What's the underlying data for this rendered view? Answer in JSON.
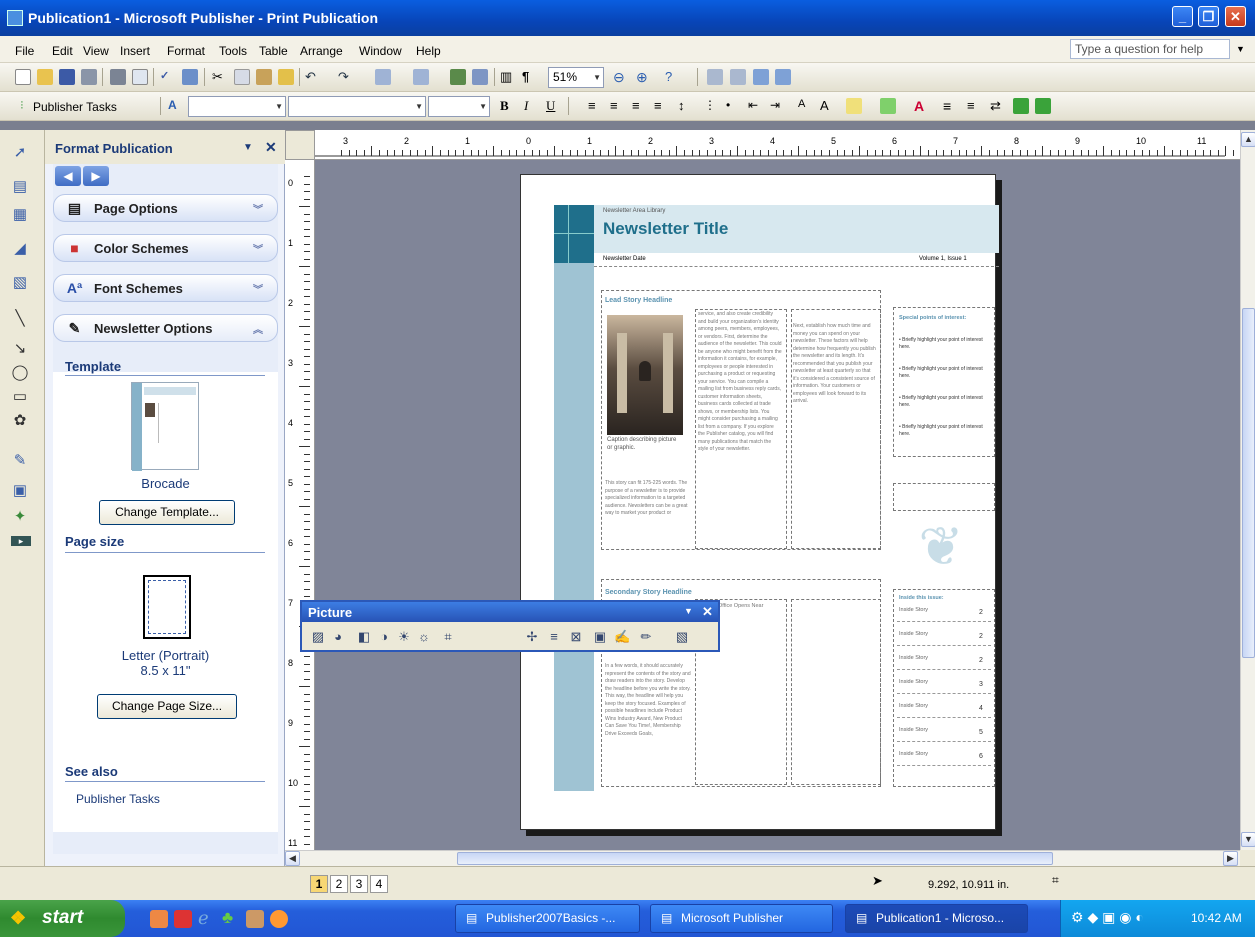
{
  "window": {
    "title": "Publication1 - Microsoft Publisher - Print Publication"
  },
  "menu": {
    "items": [
      "File",
      "Edit",
      "View",
      "Insert",
      "Format",
      "Tools",
      "Table",
      "Arrange",
      "Window",
      "Help"
    ],
    "ask_placeholder": "Type a question for help"
  },
  "toolbar": {
    "zoom": "51%",
    "publisher_tasks": "Publisher Tasks"
  },
  "taskpane": {
    "title": "Format Publication",
    "sections": [
      "Page Options",
      "Color Schemes",
      "Font Schemes",
      "Newsletter Options"
    ],
    "template_heading": "Template",
    "template_name": "Brocade",
    "change_template": "Change Template...",
    "page_size_heading": "Page size",
    "page_size_name": "Letter (Portrait)",
    "page_size_dims": "8.5 x 11\"",
    "change_page_size": "Change Page Size...",
    "see_also_heading": "See also",
    "see_also_link": "Publisher Tasks"
  },
  "ruler": {
    "h_ticks": [
      "3",
      "2",
      "1",
      "0",
      "1",
      "2",
      "3",
      "4",
      "5",
      "6",
      "7",
      "8",
      "9",
      "10",
      "11"
    ],
    "v_ticks": [
      "0",
      "1",
      "2",
      "3",
      "4",
      "5",
      "6",
      "7",
      "8",
      "9",
      "10",
      "11"
    ]
  },
  "newsletter": {
    "org": "Newsletter Area Library",
    "title": "Newsletter Title",
    "date": "Newsletter Date",
    "volume": "Volume 1, Issue 1",
    "lead_headline": "Lead Story Headline",
    "caption": "Caption describing picture or graphic.",
    "lead_col1": "This story can fit 175-225 words. The purpose of a newsletter is to provide specialized information to a targeted audience. Newsletters can be a great way to market your product or",
    "lead_col2": "service, and also create credibility and build your organization's identity among peers, members, employees, or vendors. First, determine the audience of the newsletter. This could be anyone who might benefit from the information it contains, for example, employees or people interested in purchasing a product or requesting your service. You can compile a mailing list from business reply cards, customer information sheets, business cards collected at trade shows, or membership lists. You might consider purchasing a mailing list from a company. If you explore the Publisher catalog, you will find many publications that match the style of your newsletter.",
    "lead_col3": "Next, establish how much time and money you can spend on your newsletter. These factors will help determine how frequently you publish the newsletter and its length. It's recommended that you publish your newsletter at least quarterly so that it's considered a consistent source of information. Your customers or employees will look forward to its arrival.",
    "special_heading": "Special points of interest:",
    "special_points": [
      "Briefly highlight your point of interest here.",
      "Briefly highlight your point of interest here.",
      "Briefly highlight your point of interest here.",
      "Briefly highlight your point of interest here."
    ],
    "second_headline": "Secondary Story Headline",
    "second_col1": "In a few words, it should accurately represent the contents of the story and draw readers into the story. Develop the headline before you write the story. This way, the headline will help you keep the story focused. Examples of possible headlines include Product Wins Industry Award, New Product Can Save You Time!, Membership Drive Exceeds Goals,",
    "second_col2_start": "Office Opens Near",
    "inside_heading": "Inside this issue:",
    "inside_rows": [
      {
        "label": "Inside Story",
        "page": "2"
      },
      {
        "label": "Inside Story",
        "page": "2"
      },
      {
        "label": "Inside Story",
        "page": "2"
      },
      {
        "label": "Inside Story",
        "page": "3"
      },
      {
        "label": "Inside Story",
        "page": "4"
      },
      {
        "label": "Inside Story",
        "page": "5"
      },
      {
        "label": "Inside Story",
        "page": "6"
      }
    ]
  },
  "picture_toolbar": {
    "title": "Picture"
  },
  "status": {
    "pages": [
      "1",
      "2",
      "3",
      "4"
    ],
    "coords": "9.292, 10.911 in."
  },
  "taskbar": {
    "start": "start",
    "tasks": [
      "Publisher2007Basics -...",
      "Microsoft Publisher",
      "Publication1 - Microso..."
    ],
    "clock": "10:42 AM"
  },
  "colors": {
    "accent": "#0a5ee0",
    "newsletter_teal": "#1f6f8b",
    "brocade_blue": "#86b2c9"
  }
}
